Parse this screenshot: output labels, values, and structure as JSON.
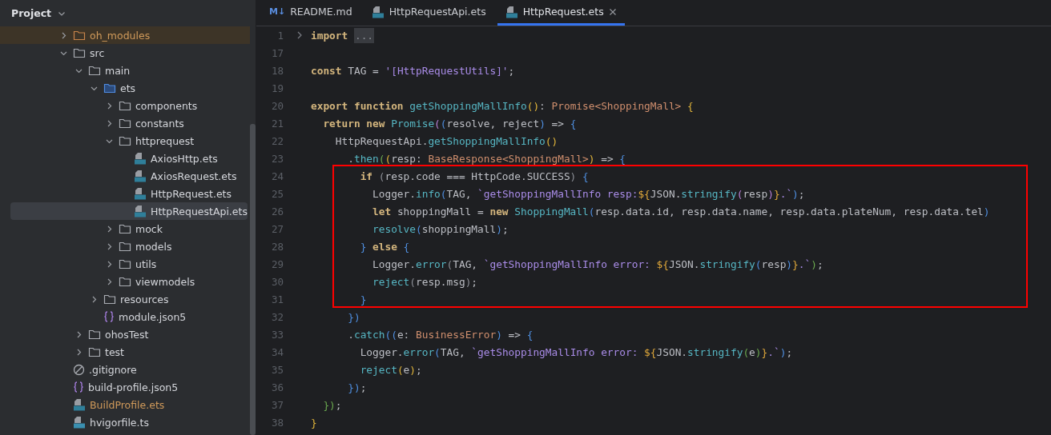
{
  "sidebar": {
    "title": "Project",
    "tree": [
      {
        "label": "oh_modules",
        "kind": "excluded_folder",
        "expanded": false,
        "selected": false
      },
      {
        "label": "src",
        "kind": "folder",
        "expanded": true,
        "selected": false,
        "children": [
          {
            "label": "main",
            "kind": "folder",
            "expanded": true,
            "selected": false,
            "children": [
              {
                "label": "ets",
                "kind": "source_folder",
                "expanded": true,
                "selected": false,
                "children": [
                  {
                    "label": "components",
                    "kind": "folder",
                    "expanded": false,
                    "selected": false
                  },
                  {
                    "label": "constants",
                    "kind": "folder",
                    "expanded": false,
                    "selected": false
                  },
                  {
                    "label": "httprequest",
                    "kind": "folder",
                    "expanded": true,
                    "selected": false,
                    "children": [
                      {
                        "label": "AxiosHttp.ets",
                        "kind": "ets_file",
                        "selected": false
                      },
                      {
                        "label": "AxiosRequest.ets",
                        "kind": "ets_file",
                        "selected": false
                      },
                      {
                        "label": "HttpRequest.ets",
                        "kind": "ets_file",
                        "selected": false
                      },
                      {
                        "label": "HttpRequestApi.ets",
                        "kind": "ets_file",
                        "selected": true
                      }
                    ]
                  },
                  {
                    "label": "mock",
                    "kind": "folder",
                    "expanded": false,
                    "selected": false
                  },
                  {
                    "label": "models",
                    "kind": "folder",
                    "expanded": false,
                    "selected": false
                  },
                  {
                    "label": "utils",
                    "kind": "folder",
                    "expanded": false,
                    "selected": false
                  },
                  {
                    "label": "viewmodels",
                    "kind": "folder",
                    "expanded": false,
                    "selected": false
                  }
                ]
              },
              {
                "label": "resources",
                "kind": "folder",
                "expanded": false,
                "selected": false
              },
              {
                "label": "module.json5",
                "kind": "json_file",
                "selected": false
              }
            ]
          },
          {
            "label": "ohosTest",
            "kind": "folder",
            "expanded": false,
            "selected": false
          },
          {
            "label": "test",
            "kind": "folder",
            "expanded": false,
            "selected": false
          }
        ]
      },
      {
        "label": ".gitignore",
        "kind": "ignore_file",
        "selected": false
      },
      {
        "label": "build-profile.json5",
        "kind": "json_file",
        "selected": false
      },
      {
        "label": "BuildProfile.ets",
        "kind": "generated_ets_file",
        "selected": false
      },
      {
        "label": "hvigorfile.ts",
        "kind": "ts_file",
        "selected": false
      }
    ]
  },
  "tabs": [
    {
      "label": "README.md",
      "kind": "markdown",
      "badge": "M↓",
      "selected": false
    },
    {
      "label": "HttpRequestApi.ets",
      "kind": "ets",
      "selected": false
    },
    {
      "label": "HttpRequest.ets",
      "kind": "ets",
      "selected": true
    }
  ],
  "editor": {
    "sections": [
      {
        "boxed": false,
        "lines": [
          {
            "number": "1",
            "folded": true,
            "tokens": [
              {
                "kind": "kw",
                "text": "import "
              },
              {
                "kind": "fold",
                "text": "..."
              }
            ]
          },
          {
            "number": "17",
            "folded": false
          },
          {
            "number": "18",
            "folded": false,
            "tokens": [
              {
                "kind": "kw",
                "text": "const"
              },
              {
                "kind": "plain",
                "text": " TAG = "
              },
              {
                "kind": "str",
                "text": "'[HttpRequestUtils]'"
              },
              {
                "kind": "plain",
                "text": ";"
              }
            ]
          },
          {
            "number": "19",
            "folded": false
          },
          {
            "number": "20",
            "folded": false,
            "tokens": [
              {
                "kind": "kw",
                "text": "export function "
              },
              {
                "kind": "fn",
                "text": "getShoppingMallInfo"
              },
              {
                "kind": "y",
                "text": "()"
              },
              {
                "kind": "plain",
                "text": ": "
              },
              {
                "kind": "type",
                "text": "Promise<ShoppingMall> "
              },
              {
                "kind": "y",
                "text": "{"
              }
            ]
          },
          {
            "number": "21",
            "folded": false,
            "tokens": [
              {
                "kind": "kw",
                "text": "  return new "
              },
              {
                "kind": "fn",
                "text": "Promise"
              },
              {
                "kind": "p",
                "text": "("
              },
              {
                "kind": "b",
                "text": "("
              },
              {
                "kind": "plain",
                "text": "resolve, reject"
              },
              {
                "kind": "b",
                "text": ")"
              },
              {
                "kind": "plain",
                "text": " => "
              },
              {
                "kind": "b",
                "text": "{"
              }
            ]
          },
          {
            "number": "22",
            "folded": false,
            "tokens": [
              {
                "kind": "plain",
                "text": "    HttpRequestApi."
              },
              {
                "kind": "fn",
                "text": "getShoppingMallInfo"
              },
              {
                "kind": "y",
                "text": "()"
              }
            ]
          },
          {
            "number": "23",
            "folded": false,
            "tokens": [
              {
                "kind": "plain",
                "text": "      ."
              },
              {
                "kind": "fn",
                "text": "then"
              },
              {
                "kind": "g",
                "text": "("
              },
              {
                "kind": "y",
                "text": "("
              },
              {
                "kind": "plain",
                "text": "resp: "
              },
              {
                "kind": "type",
                "text": "BaseResponse<ShoppingMall>"
              },
              {
                "kind": "y",
                "text": ")"
              },
              {
                "kind": "plain",
                "text": " => "
              },
              {
                "kind": "b",
                "text": "{"
              }
            ]
          }
        ]
      },
      {
        "boxed": true,
        "lines": [
          {
            "number": "24",
            "folded": false,
            "tokens": [
              {
                "kind": "kw",
                "text": "        if "
              },
              {
                "kind": "punct",
                "text": "("
              },
              {
                "kind": "plain",
                "text": "resp.code === HttpCode.SUCCESS"
              },
              {
                "kind": "punct",
                "text": ")"
              },
              {
                "kind": "b",
                "text": " {"
              }
            ]
          },
          {
            "number": "25",
            "folded": false,
            "tokens": [
              {
                "kind": "plain",
                "text": "          Logger."
              },
              {
                "kind": "fn",
                "text": "info"
              },
              {
                "kind": "b",
                "text": "("
              },
              {
                "kind": "plain",
                "text": "TAG, "
              },
              {
                "kind": "tpl",
                "text": "`getShoppingMallInfo resp:"
              },
              {
                "kind": "interp",
                "text": "${"
              },
              {
                "kind": "plain",
                "text": "JSON."
              },
              {
                "kind": "fn",
                "text": "stringify"
              },
              {
                "kind": "p",
                "text": "("
              },
              {
                "kind": "plain",
                "text": "resp"
              },
              {
                "kind": "p",
                "text": ")"
              },
              {
                "kind": "interp",
                "text": "}"
              },
              {
                "kind": "tpl",
                "text": ".`"
              },
              {
                "kind": "b",
                "text": ")"
              },
              {
                "kind": "plain",
                "text": ";"
              }
            ]
          },
          {
            "number": "26",
            "folded": false,
            "tokens": [
              {
                "kind": "kw",
                "text": "          let "
              },
              {
                "kind": "plain",
                "text": "shoppingMall = "
              },
              {
                "kind": "kw",
                "text": "new "
              },
              {
                "kind": "fn",
                "text": "ShoppingMall"
              },
              {
                "kind": "b",
                "text": "("
              },
              {
                "kind": "plain",
                "text": "resp.data.id, resp.data.name, resp.data.plateNum, resp.data.tel"
              },
              {
                "kind": "b",
                "text": ")"
              }
            ]
          },
          {
            "number": "27",
            "folded": false,
            "tokens": [
              {
                "kind": "fn",
                "text": "          resolve"
              },
              {
                "kind": "b",
                "text": "("
              },
              {
                "kind": "plain",
                "text": "shoppingMall"
              },
              {
                "kind": "b",
                "text": ")"
              },
              {
                "kind": "plain",
                "text": ";"
              }
            ]
          },
          {
            "number": "28",
            "folded": false,
            "tokens": [
              {
                "kind": "b",
                "text": "        } "
              },
              {
                "kind": "kw",
                "text": "else "
              },
              {
                "kind": "b",
                "text": "{"
              }
            ]
          },
          {
            "number": "29",
            "folded": false,
            "tokens": [
              {
                "kind": "plain",
                "text": "          Logger."
              },
              {
                "kind": "fn",
                "text": "error"
              },
              {
                "kind": "punct",
                "text": "("
              },
              {
                "kind": "plain",
                "text": "TAG, "
              },
              {
                "kind": "tpl",
                "text": "`getShoppingMallInfo error: "
              },
              {
                "kind": "interp",
                "text": "${"
              },
              {
                "kind": "plain",
                "text": "JSON."
              },
              {
                "kind": "fn",
                "text": "stringify"
              },
              {
                "kind": "b",
                "text": "("
              },
              {
                "kind": "plain",
                "text": "resp"
              },
              {
                "kind": "b",
                "text": ")"
              },
              {
                "kind": "interp",
                "text": "}"
              },
              {
                "kind": "tpl",
                "text": ".`"
              },
              {
                "kind": "g",
                "text": ")"
              },
              {
                "kind": "plain",
                "text": ";"
              }
            ]
          },
          {
            "number": "30",
            "folded": false,
            "tokens": [
              {
                "kind": "fn",
                "text": "          reject"
              },
              {
                "kind": "punct",
                "text": "("
              },
              {
                "kind": "plain",
                "text": "resp.msg"
              },
              {
                "kind": "punct",
                "text": ")"
              },
              {
                "kind": "plain",
                "text": ";"
              }
            ]
          },
          {
            "number": "31",
            "folded": false,
            "tokens": [
              {
                "kind": "b",
                "text": "        }"
              }
            ]
          }
        ]
      },
      {
        "boxed": false,
        "lines": [
          {
            "number": "32",
            "folded": false,
            "tokens": [
              {
                "kind": "b",
                "text": "      })"
              }
            ]
          },
          {
            "number": "33",
            "folded": false,
            "tokens": [
              {
                "kind": "plain",
                "text": "      ."
              },
              {
                "kind": "fn",
                "text": "catch"
              },
              {
                "kind": "b",
                "text": "(("
              },
              {
                "kind": "plain",
                "text": "e: "
              },
              {
                "kind": "type",
                "text": "BusinessError"
              },
              {
                "kind": "b",
                "text": ")"
              },
              {
                "kind": "plain",
                "text": " => "
              },
              {
                "kind": "b",
                "text": "{"
              }
            ]
          },
          {
            "number": "34",
            "folded": false,
            "tokens": [
              {
                "kind": "plain",
                "text": "        Logger."
              },
              {
                "kind": "fn",
                "text": "error"
              },
              {
                "kind": "b",
                "text": "("
              },
              {
                "kind": "plain",
                "text": "TAG, "
              },
              {
                "kind": "tpl",
                "text": "`getShoppingMallInfo error: "
              },
              {
                "kind": "interp",
                "text": "${"
              },
              {
                "kind": "plain",
                "text": "JSON."
              },
              {
                "kind": "fn",
                "text": "stringify"
              },
              {
                "kind": "g",
                "text": "("
              },
              {
                "kind": "plain",
                "text": "e"
              },
              {
                "kind": "g",
                "text": ")"
              },
              {
                "kind": "interp",
                "text": "}"
              },
              {
                "kind": "tpl",
                "text": ".`"
              },
              {
                "kind": "b",
                "text": ")"
              },
              {
                "kind": "plain",
                "text": ";"
              }
            ]
          },
          {
            "number": "35",
            "folded": false,
            "tokens": [
              {
                "kind": "fn",
                "text": "        reject"
              },
              {
                "kind": "y",
                "text": "("
              },
              {
                "kind": "plain",
                "text": "e"
              },
              {
                "kind": "y",
                "text": ")"
              },
              {
                "kind": "plain",
                "text": ";"
              }
            ]
          },
          {
            "number": "36",
            "folded": false,
            "tokens": [
              {
                "kind": "b",
                "text": "      })"
              },
              {
                "kind": "plain",
                "text": ";"
              }
            ]
          },
          {
            "number": "37",
            "folded": false,
            "tokens": [
              {
                "kind": "g",
                "text": "  })"
              },
              {
                "kind": "plain",
                "text": ";"
              }
            ]
          },
          {
            "number": "38",
            "folded": false,
            "tokens": [
              {
                "kind": "y",
                "text": "}"
              }
            ]
          }
        ]
      }
    ]
  }
}
